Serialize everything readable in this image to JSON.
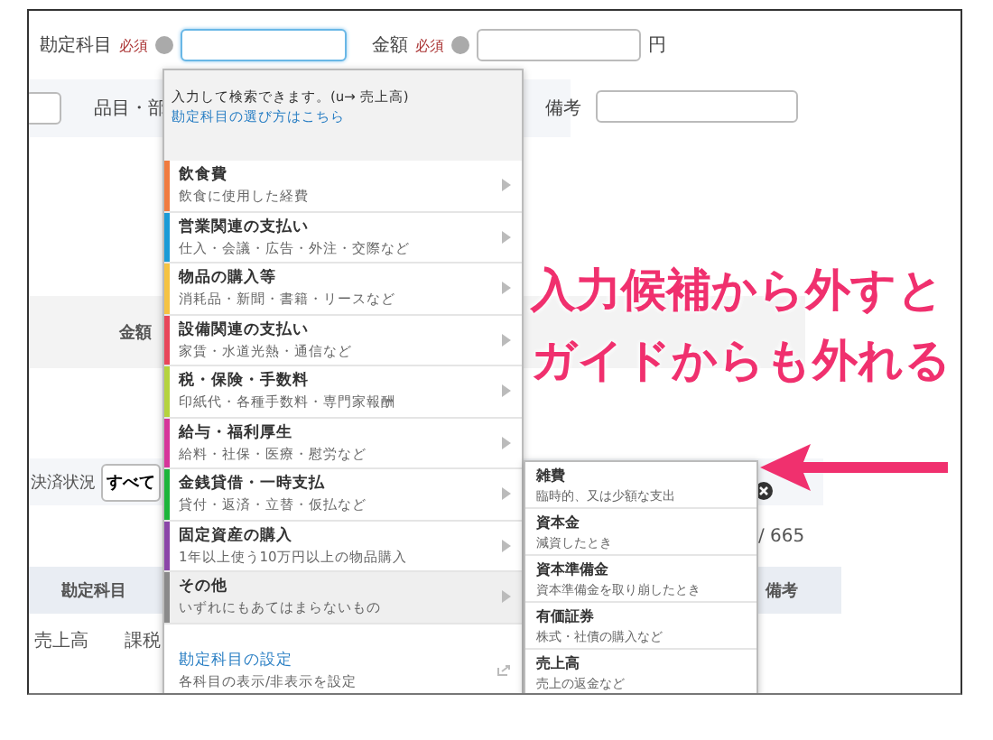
{
  "form": {
    "account_label": "勘定科目",
    "account_required": "必須",
    "account_focused": true,
    "amount_label": "金額",
    "amount_required": "必須",
    "amount_unit": "円",
    "item_label": "品目・部",
    "memo_label": "備考"
  },
  "table_header": {
    "column_2": "金額"
  },
  "filter": {
    "label": "決済状況",
    "value": "すべて"
  },
  "pagination": "/ 665",
  "list_header": {
    "account": "勘定科目",
    "memo": "備考"
  },
  "list_row": {
    "account": "売上高",
    "tax": "課税"
  },
  "dropdown": {
    "hint": "入力して検索できます。(u→ 売上高)",
    "guide_link": "勘定科目の選び方はこちら",
    "categories": [
      {
        "title": "飲食費",
        "description": "飲食に使用した経費",
        "color": "#f07b3f",
        "selected": false
      },
      {
        "title": "営業関連の支払い",
        "description": "仕入・会議・広告・外注・交際など",
        "color": "#1a9bd7",
        "selected": false
      },
      {
        "title": "物品の購入等",
        "description": "消耗品・新聞・書籍・リースなど",
        "color": "#f5c342",
        "selected": false
      },
      {
        "title": "設備関連の支払い",
        "description": "家賃・水道光熱・通信など",
        "color": "#e8465a",
        "selected": false
      },
      {
        "title": "税・保険・手数料",
        "description": "印紙代・各種手数料・専門家報酬",
        "color": "#b5d33d",
        "selected": false
      },
      {
        "title": "給与・福利厚生",
        "description": "給料・社保・医療・慰労など",
        "color": "#d6359a",
        "selected": false
      },
      {
        "title": "金銭貸借・一時支払",
        "description": "貸付・返済・立替・仮払など",
        "color": "#1cb53a",
        "selected": false
      },
      {
        "title": "固定資産の購入",
        "description": "1年以上使う10万円以上の物品購入",
        "color": "#8b45a8",
        "selected": false
      },
      {
        "title": "その他",
        "description": "いずれにもあてはまらないもの",
        "color": "#8a8a8a",
        "selected": true
      }
    ],
    "settings": {
      "title": "勘定科目の設定",
      "description": "各科目の表示/非表示を設定"
    }
  },
  "submenu": [
    {
      "title": "雑費",
      "description": "臨時的、又は少額な支出"
    },
    {
      "title": "資本金",
      "description": "減資したとき"
    },
    {
      "title": "資本準備金",
      "description": "資本準備金を取り崩したとき"
    },
    {
      "title": "有価証券",
      "description": "株式・社債の購入など"
    },
    {
      "title": "売上高",
      "description": "売上の返金など"
    }
  ],
  "annotation": [
    "入力候補から外すと",
    "ガイドからも外れる"
  ]
}
